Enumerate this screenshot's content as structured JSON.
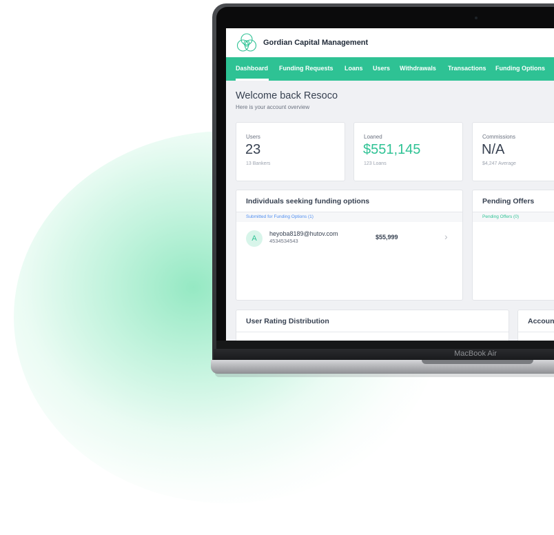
{
  "app": {
    "title": "Gordian Capital Management",
    "accent_color": "#2ec294"
  },
  "nav": {
    "items": [
      {
        "label": "Dashboard",
        "active": true
      },
      {
        "label": "Funding Requests"
      },
      {
        "label": "Loans"
      },
      {
        "label": "Users"
      },
      {
        "label": "Withdrawals"
      },
      {
        "label": "Transactions"
      },
      {
        "label": "Funding Options"
      }
    ]
  },
  "welcome": {
    "title": "Welcome back Resoco",
    "subtitle": "Here is your account overview"
  },
  "stats": [
    {
      "label": "Users",
      "value": "23",
      "sub": "13 Bankers"
    },
    {
      "label": "Loaned",
      "value": "$551,145",
      "sub": "123 Loans"
    },
    {
      "label": "Commissions",
      "value": "N/A",
      "sub": "$4,247 Average"
    }
  ],
  "funding_panel": {
    "title": "Individuals seeking funding options",
    "subtitle": "Submitted for Funding Options (1)",
    "rows": [
      {
        "avatar": "A",
        "email": "heyoba8189@hutov.com",
        "phone": "4534534543",
        "amount": "$55,999",
        "chevron_icon": "chevron-right-icon"
      }
    ]
  },
  "pending_panel": {
    "title": "Pending Offers",
    "subtitle": "Pending Offers (0)"
  },
  "rating_panel": {
    "title": "User Rating Distribution"
  },
  "account_panel": {
    "title": "Accoun"
  },
  "device": {
    "label": "MacBook Air"
  }
}
